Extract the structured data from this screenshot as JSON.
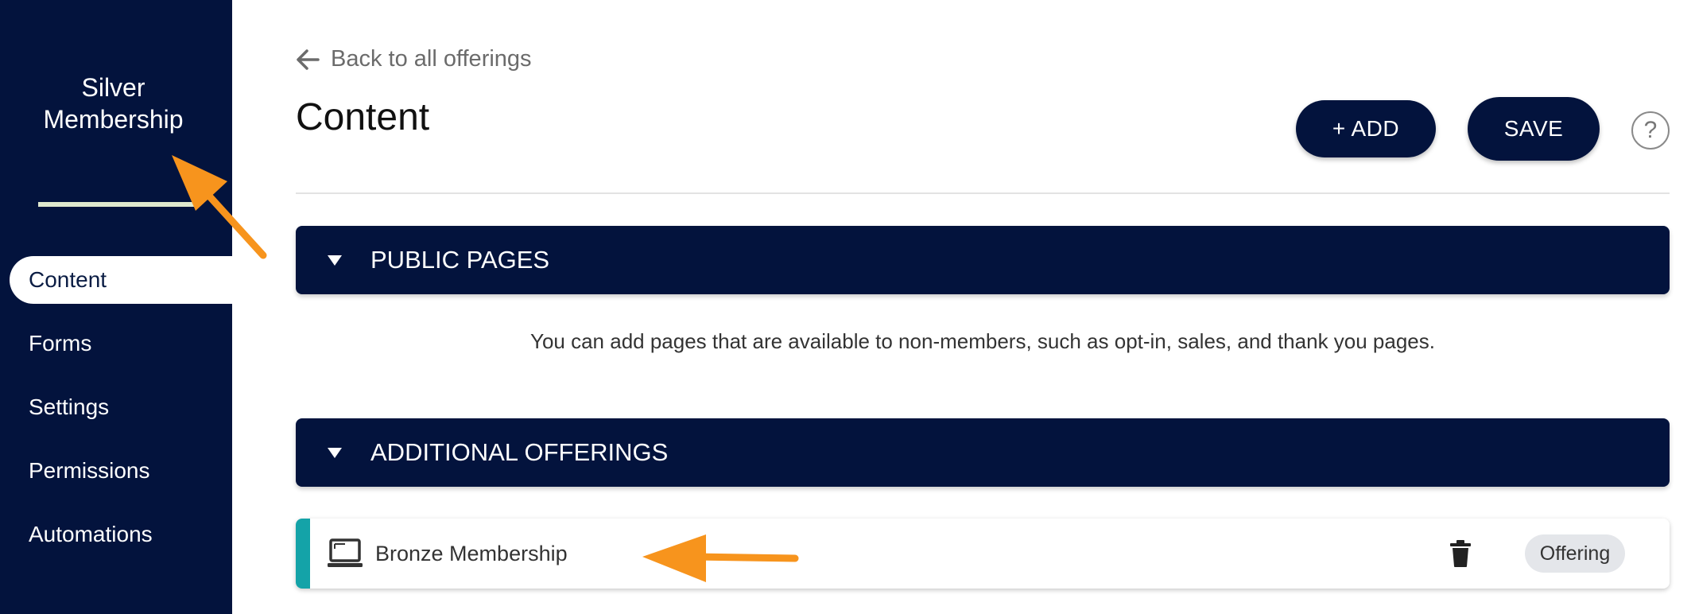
{
  "sidebar": {
    "title": "Silver\nMembership",
    "items": [
      {
        "label": "Content",
        "active": true
      },
      {
        "label": "Forms"
      },
      {
        "label": "Settings"
      },
      {
        "label": "Permissions"
      },
      {
        "label": "Automations"
      }
    ]
  },
  "header": {
    "back_label": "Back to all offerings",
    "title": "Content",
    "add_label": "+ ADD",
    "save_label": "SAVE",
    "help_label": "?"
  },
  "sections": {
    "public": {
      "title": "PUBLIC PAGES",
      "note": "You can add pages that are available to non-members, such as opt-in, sales, and thank you pages."
    },
    "additional": {
      "title": "ADDITIONAL OFFERINGS",
      "items": [
        {
          "name": "Bronze Membership",
          "badge": "Offering"
        }
      ]
    }
  },
  "colors": {
    "navy": "#03133d",
    "accent_teal": "#14a3a8",
    "annotation_orange": "#f7941d"
  },
  "icons": [
    "arrow-left-icon",
    "caret-down-icon",
    "laptop-icon",
    "trash-icon",
    "help-icon"
  ]
}
